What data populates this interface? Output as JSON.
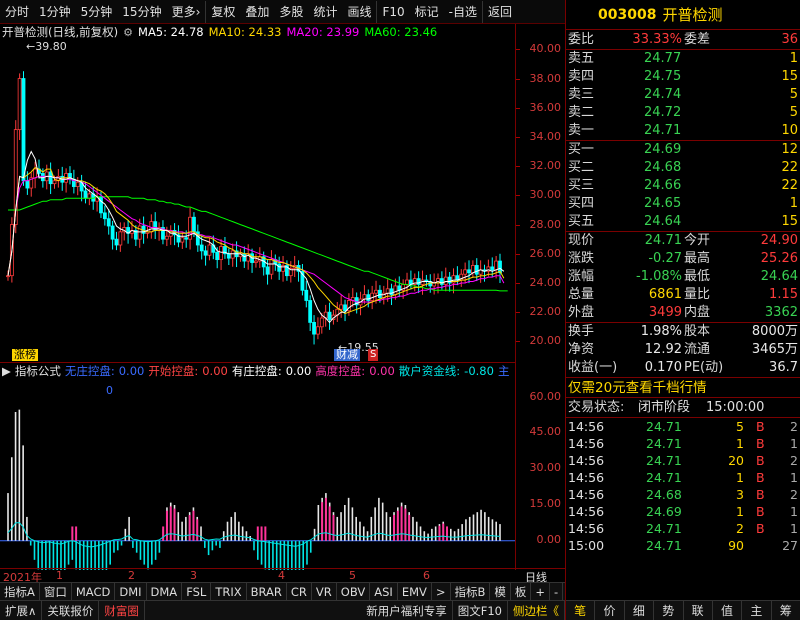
{
  "toolbar": {
    "items": [
      "分时",
      "1分钟",
      "5分钟",
      "15分钟",
      "更多›",
      "复权",
      "叠加",
      "多股",
      "统计",
      "画线",
      "F10",
      "标记",
      "-自选",
      "返回"
    ]
  },
  "chart_info": {
    "name": "开普检测(日线,前复权)",
    "ma5": "MA5: 24.78",
    "ma10": "MA10: 24.33",
    "ma20": "MA20: 23.99",
    "ma60": "MA60: 23.46",
    "high_mark": "39.80",
    "low_mark": "19.55",
    "tag_left": "涨榜",
    "tag_mid": "财减",
    "tag_mid2": "S"
  },
  "colors": {
    "ma5": "#ffffff",
    "ma10": "#ffd700",
    "ma20": "#ff00ff",
    "ma60": "#00ff00",
    "up": "#ff3b3b",
    "down": "#00ffff"
  },
  "chart_data": [
    {
      "type": "candlestick",
      "ylim": [
        19.0,
        40.5
      ],
      "yticks": [
        "40.00",
        "38.00",
        "36.00",
        "34.00",
        "32.00",
        "30.00",
        "28.00",
        "26.00",
        "24.00",
        "22.00",
        "20.00"
      ],
      "close": [
        24.5,
        28.0,
        34.5,
        38.0,
        31.0,
        30.5,
        31.2,
        31.8,
        31.5,
        31.0,
        31.6,
        30.8,
        31.0,
        31.3,
        30.9,
        31.5,
        31.1,
        30.6,
        30.9,
        30.3,
        29.8,
        30.1,
        29.6,
        29.9,
        28.8,
        28.4,
        27.9,
        27.0,
        26.6,
        27.5,
        27.8,
        27.4,
        27.6,
        27.0,
        27.9,
        27.4,
        27.5,
        28.2,
        27.6,
        27.8,
        27.0,
        27.2,
        27.6,
        27.3,
        26.8,
        27.1,
        27.0,
        28.5,
        27.5,
        26.6,
        26.2,
        25.9,
        26.6,
        26.1,
        25.6,
        26.5,
        26.0,
        25.7,
        26.2,
        25.8,
        26.0,
        25.5,
        26.0,
        25.4,
        25.5,
        25.8,
        25.1,
        24.6,
        25.6,
        25.3,
        24.8,
        25.2,
        24.5,
        25.0,
        25.2,
        24.8,
        23.5,
        22.8,
        21.3,
        20.5,
        21.0,
        21.6,
        22.0,
        21.5,
        21.8,
        22.2,
        22.5,
        22.1,
        22.8,
        23.0,
        22.5,
        22.9,
        23.2,
        22.8,
        23.3,
        23.5,
        23.0,
        23.3,
        23.6,
        23.2,
        23.8,
        23.5,
        23.9,
        24.2,
        23.9,
        24.3,
        23.9,
        24.2,
        24.1,
        23.8,
        24.0,
        24.3,
        23.9,
        24.4,
        24.0,
        24.5,
        24.2,
        24.6,
        24.9,
        24.7,
        25.2,
        24.6,
        24.9,
        24.8,
        25.1,
        24.9,
        25.5,
        24.71
      ],
      "ma5": [
        24.5,
        26.2,
        29.0,
        31.3,
        31.2,
        32.4,
        33.0,
        32.5,
        31.2,
        31.2,
        31.3,
        31.3,
        31.2,
        31.2,
        31.1,
        31.1,
        31.2,
        31.1,
        31.0,
        30.9,
        30.5,
        30.3,
        30.1,
        29.9,
        29.6,
        29.4,
        29.0,
        28.5,
        27.9,
        27.7,
        27.6,
        27.4,
        27.6,
        27.5,
        27.5,
        27.5,
        27.6,
        27.7,
        27.7,
        27.7,
        27.6,
        27.6,
        27.4,
        27.4,
        27.2,
        27.2,
        27.2,
        27.3,
        27.4,
        27.2,
        27.0,
        26.9,
        26.8,
        26.6,
        26.2,
        26.1,
        26.1,
        26.0,
        26.0,
        26.0,
        26.0,
        25.8,
        25.9,
        25.7,
        25.7,
        25.6,
        25.5,
        25.3,
        25.3,
        25.3,
        25.1,
        25.1,
        25.1,
        24.9,
        24.9,
        24.9,
        24.6,
        24.3,
        23.6,
        22.8,
        22.2,
        21.8,
        21.6,
        21.3,
        21.6,
        21.8,
        22.0,
        22.0,
        22.3,
        22.5,
        22.6,
        22.7,
        22.9,
        22.9,
        23.0,
        23.1,
        23.2,
        23.2,
        23.3,
        23.3,
        23.4,
        23.5,
        23.6,
        23.7,
        23.9,
        24.0,
        24.0,
        24.1,
        24.1,
        24.1,
        24.0,
        24.1,
        24.0,
        24.1,
        24.1,
        24.2,
        24.2,
        24.3,
        24.4,
        24.5,
        24.7,
        24.8,
        24.9,
        24.8,
        24.9,
        24.8,
        24.9,
        25.0,
        24.8
      ],
      "ma10": [
        24.5,
        26.2,
        29.0,
        31.3,
        31.2,
        31.4,
        31.6,
        31.9,
        31.8,
        31.6,
        31.8,
        31.8,
        31.1,
        31.0,
        31.2,
        31.2,
        31.2,
        31.1,
        31.0,
        31.0,
        30.9,
        30.8,
        30.6,
        30.4,
        30.3,
        30.1,
        29.8,
        29.4,
        28.9,
        28.7,
        28.5,
        28.3,
        28.0,
        27.8,
        27.7,
        27.6,
        27.5,
        27.5,
        27.6,
        27.6,
        27.6,
        27.6,
        27.5,
        27.5,
        27.4,
        27.4,
        27.4,
        27.5,
        27.5,
        27.3,
        27.2,
        27.1,
        27.1,
        27.0,
        26.8,
        26.7,
        26.6,
        26.4,
        26.3,
        26.1,
        26.1,
        26.0,
        26.0,
        25.8,
        25.8,
        25.8,
        25.7,
        25.6,
        25.6,
        25.5,
        25.4,
        25.4,
        25.3,
        25.2,
        25.1,
        25.0,
        24.9,
        24.7,
        24.4,
        24.1,
        23.7,
        23.4,
        23.1,
        22.8,
        22.5,
        22.3,
        22.1,
        21.9,
        22.0,
        22.1,
        22.2,
        22.3,
        22.4,
        22.6,
        22.7,
        22.8,
        22.9,
        23.0,
        23.1,
        23.1,
        23.2,
        23.3,
        23.4,
        23.5,
        23.6,
        23.7,
        23.7,
        23.8,
        23.9,
        24.0,
        24.0,
        24.0,
        24.0,
        24.1,
        24.1,
        24.1,
        24.1,
        24.2,
        24.2,
        24.3,
        24.4,
        24.4,
        24.5,
        24.5,
        24.6,
        24.6,
        24.7,
        24.8,
        24.33
      ],
      "ma20": [
        24.5,
        26.2,
        29.0,
        30.5,
        31.0,
        31.0,
        31.1,
        31.2,
        31.3,
        31.3,
        31.3,
        31.3,
        31.2,
        31.2,
        31.1,
        31.1,
        31.1,
        31.0,
        31.0,
        30.9,
        30.8,
        30.6,
        30.4,
        30.2,
        30.0,
        29.8,
        29.6,
        29.4,
        29.2,
        29.0,
        28.8,
        28.6,
        28.4,
        28.3,
        28.1,
        28.0,
        27.9,
        27.8,
        27.8,
        27.7,
        27.7,
        27.6,
        27.6,
        27.5,
        27.5,
        27.5,
        27.4,
        27.4,
        27.4,
        27.3,
        27.3,
        27.2,
        27.2,
        27.1,
        27.0,
        26.9,
        26.8,
        26.7,
        26.6,
        26.6,
        26.5,
        26.4,
        26.3,
        26.2,
        26.1,
        26.0,
        25.9,
        25.8,
        25.7,
        25.6,
        25.5,
        25.4,
        25.3,
        25.2,
        25.1,
        25.0,
        24.9,
        24.8,
        24.7,
        24.6,
        24.4,
        24.2,
        24.0,
        23.8,
        23.6,
        23.4,
        23.2,
        23.0,
        22.9,
        22.8,
        22.7,
        22.7,
        22.7,
        22.7,
        22.7,
        22.8,
        22.8,
        22.9,
        22.9,
        23.0,
        23.0,
        23.1,
        23.1,
        23.2,
        23.3,
        23.3,
        23.4,
        23.5,
        23.5,
        23.6,
        23.6,
        23.7,
        23.7,
        23.8,
        23.8,
        23.9,
        23.9,
        24.0,
        24.0,
        24.1,
        24.1,
        24.2,
        24.3,
        24.3,
        24.4,
        24.4,
        24.5,
        24.5,
        23.99
      ],
      "ma60": [
        29.0,
        29.0,
        29.0,
        29.0,
        29.1,
        29.2,
        29.3,
        29.4,
        29.5,
        29.6,
        29.6,
        29.7,
        29.7,
        29.7,
        29.7,
        29.8,
        29.8,
        29.8,
        29.8,
        29.8,
        29.8,
        29.8,
        29.8,
        29.9,
        29.9,
        29.9,
        29.9,
        29.9,
        29.9,
        29.9,
        29.9,
        29.9,
        29.8,
        29.8,
        29.8,
        29.8,
        29.7,
        29.7,
        29.7,
        29.6,
        29.6,
        29.5,
        29.5,
        29.4,
        29.4,
        29.3,
        29.2,
        29.2,
        29.1,
        29.0,
        28.9,
        28.9,
        28.8,
        28.7,
        28.6,
        28.5,
        28.4,
        28.3,
        28.2,
        28.1,
        28.0,
        27.9,
        27.8,
        27.7,
        27.6,
        27.5,
        27.4,
        27.3,
        27.2,
        27.1,
        27.0,
        26.9,
        26.8,
        26.7,
        26.6,
        26.5,
        26.4,
        26.3,
        26.2,
        26.1,
        26.0,
        25.9,
        25.8,
        25.7,
        25.6,
        25.5,
        25.4,
        25.3,
        25.2,
        25.1,
        25.0,
        24.9,
        24.8,
        24.8,
        24.7,
        24.6,
        24.5,
        24.4,
        24.3,
        24.2,
        24.1,
        24.0,
        23.9,
        23.9,
        23.8,
        23.8,
        23.7,
        23.7,
        23.6,
        23.6,
        23.5,
        23.5,
        23.5,
        23.5,
        23.5,
        23.5,
        23.5,
        23.5,
        23.5,
        23.5,
        23.5,
        23.5,
        23.5,
        23.5,
        23.5,
        23.5,
        23.5,
        23.46,
        23.46,
        23.46
      ]
    },
    {
      "type": "bar",
      "ylim": [
        -11,
        67
      ],
      "yticks": [
        "60.00",
        "45.00",
        "30.00",
        "15.00",
        "0.00"
      ],
      "values": [
        20,
        35,
        54,
        55,
        40,
        10,
        -2,
        -8,
        -12,
        -15,
        -14,
        -12,
        -16,
        -18,
        -20,
        -15,
        -10,
        -8,
        -12,
        -20,
        -26,
        -28,
        -30,
        -27,
        -25,
        -20,
        -15,
        -10,
        -5,
        -4,
        -2,
        5,
        10,
        -3,
        -5,
        -8,
        -10,
        -12,
        -10,
        -8,
        -5,
        5,
        14,
        16,
        15,
        12,
        8,
        10,
        12,
        14,
        10,
        6,
        -3,
        -6,
        -4,
        -2,
        -3,
        4,
        8,
        10,
        12,
        8,
        6,
        4,
        2,
        -4,
        -8,
        -10,
        -12,
        -14,
        -16,
        -18,
        -20,
        -22,
        -24,
        -26,
        -28,
        -24,
        -20,
        -10,
        -5,
        5,
        15,
        18,
        20,
        16,
        12,
        10,
        12,
        15,
        18,
        14,
        10,
        8,
        6,
        4,
        10,
        14,
        18,
        16,
        12,
        10,
        12,
        14,
        16,
        15,
        12,
        10,
        8,
        6,
        4,
        3,
        5,
        6,
        7,
        8,
        6,
        5,
        4,
        5,
        7,
        9,
        10,
        11,
        12,
        13,
        12,
        10,
        9,
        8,
        7
      ]
    }
  ],
  "ind_header": {
    "name": "指标公式",
    "a_label": "无庄控盘:",
    "a_val": "0.00",
    "b_label": "开始控盘:",
    "b_val": "0.00",
    "c_label": "有庄控盘:",
    "c_val": "0.00",
    "d_label": "高度控盘:",
    "d_val": "0.00",
    "e_label": "散户资金线:",
    "e_val": "-0.80",
    "f_label": "主",
    "zero": "0"
  },
  "datebar": {
    "year": "2021年",
    "m1": "1",
    "m2": "2",
    "m3": "3",
    "m4": "4",
    "m5": "5",
    "m6": "6",
    "day": "日线"
  },
  "tabs": [
    "指标A",
    "窗口",
    "MACD",
    "DMI",
    "DMA",
    "FSL",
    "TRIX",
    "BRAR",
    "CR",
    "VR",
    "OBV",
    "ASI",
    "EMV",
    ">",
    "指标B",
    "模",
    "板",
    "+",
    "-"
  ],
  "bottom": [
    "扩展∧",
    "关联报价",
    "财富圈",
    "新用户福利专享",
    "图文F10",
    "侧边栏《"
  ],
  "stock": {
    "code": "003008",
    "name": "开普检测"
  },
  "order_book": {
    "webi_label": "委比",
    "webi_val": "33.33%",
    "wecha_label": "委差",
    "wecha_val": "36",
    "sell": [
      {
        "label": "卖五",
        "price": "24.77",
        "vol": "1"
      },
      {
        "label": "卖四",
        "price": "24.75",
        "vol": "15"
      },
      {
        "label": "卖三",
        "price": "24.74",
        "vol": "5"
      },
      {
        "label": "卖二",
        "price": "24.72",
        "vole": "5",
        "vol": "5"
      },
      {
        "label": "卖一",
        "price": "24.71",
        "vol": "10"
      }
    ],
    "buy": [
      {
        "label": "买一",
        "price": "24.69",
        "vol": "12"
      },
      {
        "label": "买二",
        "price": "24.68",
        "vol": "22"
      },
      {
        "label": "买三",
        "price": "24.66",
        "vol": "22"
      },
      {
        "label": "买四",
        "price": "24.65",
        "vol": "1"
      },
      {
        "label": "买五",
        "price": "24.64",
        "vol": "15"
      }
    ]
  },
  "quote": [
    {
      "l1": "现价",
      "v1": "24.71",
      "c1": "dn",
      "l2": "今开",
      "v2": "24.90",
      "c2": "up"
    },
    {
      "l1": "涨跌",
      "v1": "-0.27",
      "c1": "dn",
      "l2": "最高",
      "v2": "25.26",
      "c2": "up"
    },
    {
      "l1": "涨幅",
      "v1": "-1.08%",
      "c1": "dn",
      "l2": "最低",
      "v2": "24.64",
      "c2": "dn"
    },
    {
      "l1": "总量",
      "v1": "6861",
      "c1": "yel",
      "l2": "量比",
      "v2": "1.15",
      "c2": "up"
    },
    {
      "l1": "外盘",
      "v1": "3499",
      "c1": "up",
      "l2": "内盘",
      "v2": "3362",
      "c2": "dn"
    }
  ],
  "fin": [
    {
      "l1": "换手",
      "v1": "1.98%",
      "l2": "股本",
      "v2": "8000万"
    },
    {
      "l1": "净资",
      "v1": "12.92",
      "l2": "流通",
      "v2": "3465万"
    },
    {
      "l1": "收益(一)",
      "v1": "0.170",
      "l2": "PE(动)",
      "v2": "36.7"
    }
  ],
  "promo": "仅需20元查看千档行情",
  "trade_status": "交易状态:",
  "trade_status_val": "闭市阶段",
  "trade_status_time": "15:00:00",
  "ticks": [
    {
      "t": "14:56",
      "p": "24.71",
      "v": "5",
      "f": "B",
      "n": "2"
    },
    {
      "t": "14:56",
      "p": "24.71",
      "v": "1",
      "f": "B",
      "n": "1"
    },
    {
      "t": "14:56",
      "p": "24.71",
      "v": "20",
      "f": "B",
      "n": "2"
    },
    {
      "t": "14:56",
      "p": "24.71",
      "v": "1",
      "f": "B",
      "n": "1"
    },
    {
      "t": "14:56",
      "p": "24.68",
      "v": "3",
      "f": "B",
      "n": "2"
    },
    {
      "t": "14:56",
      "p": "24.69",
      "v": "1",
      "f": "B",
      "n": "1"
    },
    {
      "t": "14:56",
      "p": "24.71",
      "v": "2",
      "f": "B",
      "n": "1"
    },
    {
      "t": "15:00",
      "p": "24.71",
      "v": "90",
      "f": "",
      "n": "27"
    }
  ],
  "rp_tabs": [
    "笔",
    "价",
    "细",
    "势",
    "联",
    "值",
    "主",
    "筹"
  ]
}
